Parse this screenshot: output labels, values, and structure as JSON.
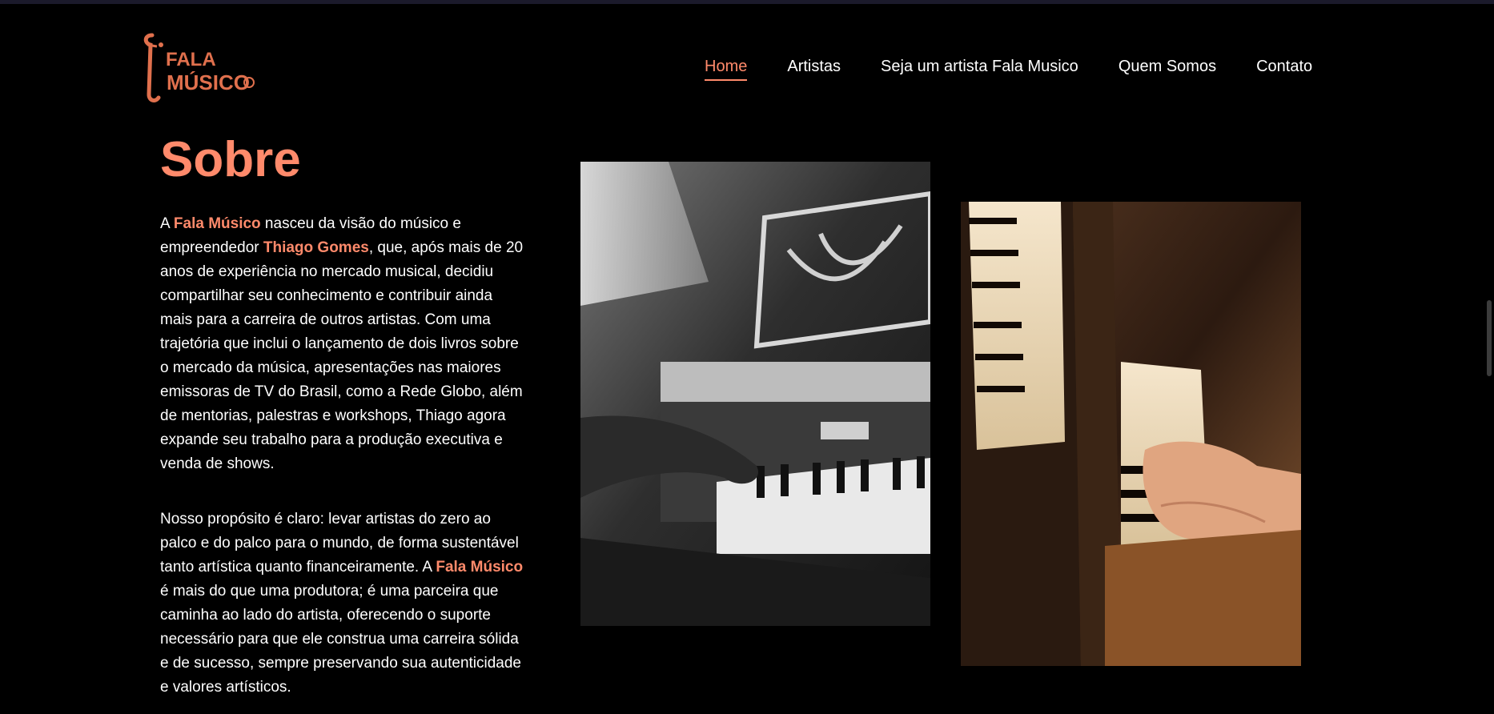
{
  "header": {
    "logo_text_line1": "FALA",
    "logo_text_line2": "MÚSICO",
    "nav": [
      {
        "label": "Home",
        "active": true
      },
      {
        "label": "Artistas",
        "active": false
      },
      {
        "label": "Seja um artista Fala Musico",
        "active": false
      },
      {
        "label": "Quem Somos",
        "active": false
      },
      {
        "label": "Contato",
        "active": false
      }
    ]
  },
  "about": {
    "title": "Sobre",
    "p1": {
      "t1": "A ",
      "h1": "Fala Músico",
      "t2": " nasceu da visão do músico e empreendedor ",
      "h2": "Thiago Gomes",
      "t3": ", que, após mais de 20 anos de experiência no mercado musical, decidiu compartilhar seu conhecimento e contribuir ainda mais para a carreira de outros artistas. Com uma trajetória que inclui o lançamento de dois livros sobre o mercado da música, apresentações nas maiores emissoras de TV do Brasil, como a Rede Globo, além de mentorias, palestras e workshops, Thiago agora expande seu trabalho para a produção executiva e venda de shows."
    },
    "p2": {
      "t1": "Nosso propósito é claro: levar artistas do zero ao palco e do palco para o mundo, de forma sustentável tanto artística quanto financeiramente. A ",
      "h1": "Fala Músico",
      "t2": " é mais do que uma produtora; é uma parceira que caminha ao lado do artista, oferecendo o suporte necessário para que ele construa uma carreira sólida e de sucesso, sempre preservando sua autenticidade e valores artísticos."
    },
    "images": [
      {
        "name": "piano-bw-photo"
      },
      {
        "name": "piano-keys-hands-photo"
      }
    ]
  },
  "colors": {
    "accent": "#ff8a6b",
    "background": "#000000",
    "text": "#ffffff"
  }
}
